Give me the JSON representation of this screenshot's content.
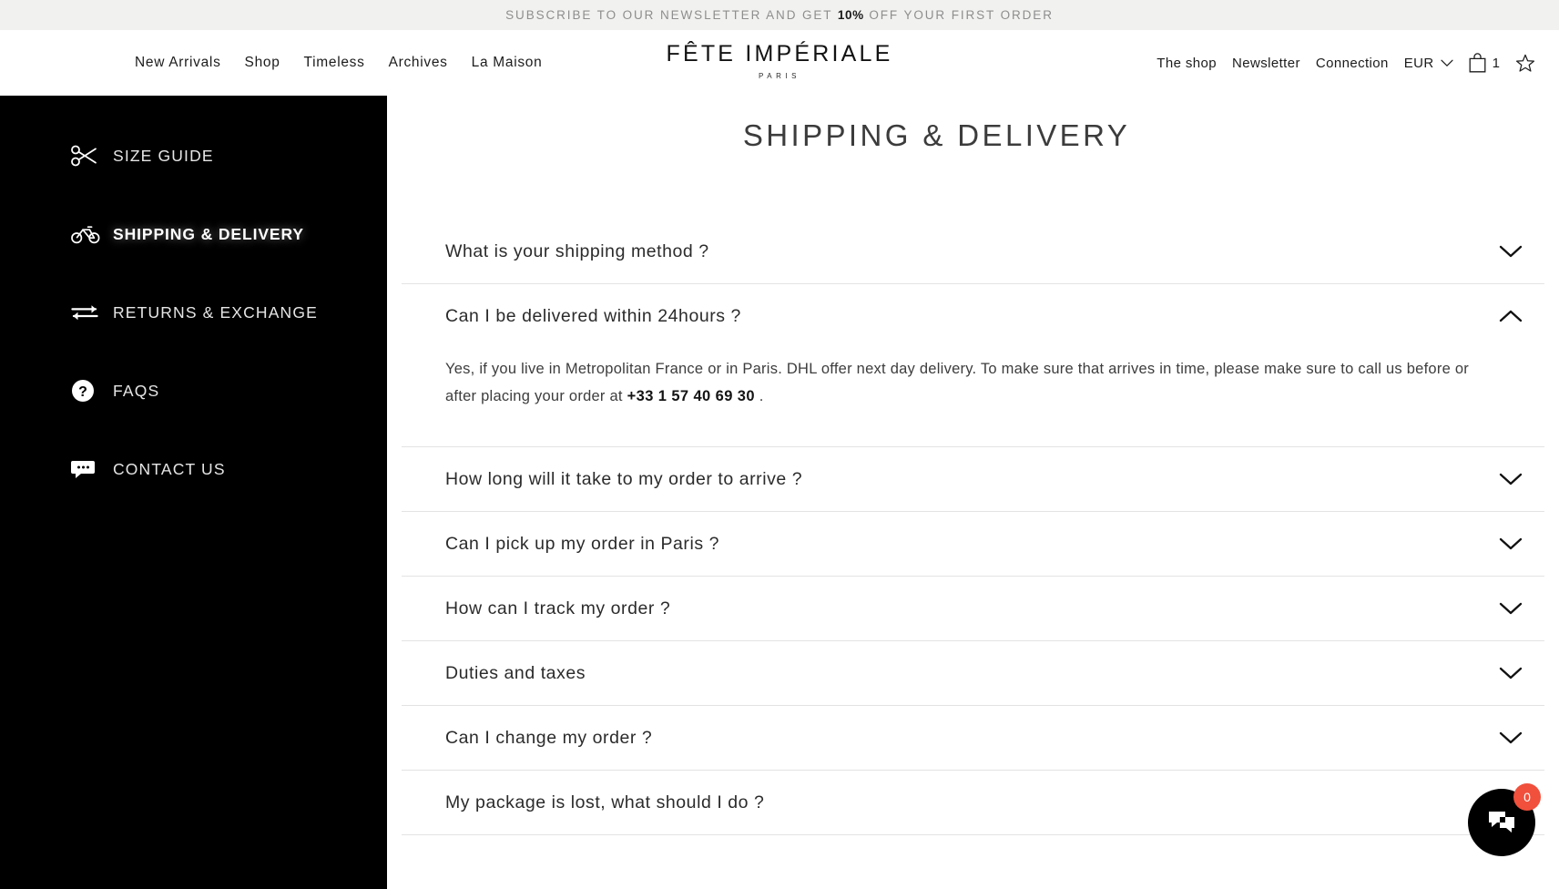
{
  "announcement": {
    "prefix": "SUBSCRIBE TO OUR NEWSLETTER AND GET ",
    "highlight": "10%",
    "suffix": " OFF YOUR FIRST ORDER"
  },
  "header": {
    "primary_nav": [
      {
        "label": "New Arrivals"
      },
      {
        "label": "Shop"
      },
      {
        "label": "Timeless"
      },
      {
        "label": "Archives"
      },
      {
        "label": "La Maison"
      }
    ],
    "brand": {
      "name": "FÊTE IMPÉRIALE",
      "tagline": "PARIS"
    },
    "utility_nav": [
      {
        "label": "The shop"
      },
      {
        "label": "Newsletter"
      },
      {
        "label": "Connection"
      }
    ],
    "currency": {
      "value": "EUR",
      "icon": "chevron-down-icon"
    },
    "cart": {
      "icon": "shopping-bag-icon",
      "count": "1"
    },
    "wishlist": {
      "icon": "star-icon"
    }
  },
  "sidebar": {
    "items": [
      {
        "label": "SIZE GUIDE",
        "icon": "scissors-icon",
        "active": false
      },
      {
        "label": "SHIPPING & DELIVERY",
        "icon": "bicycle-icon",
        "active": true
      },
      {
        "label": "RETURNS & EXCHANGE",
        "icon": "exchange-arrows-icon",
        "active": false
      },
      {
        "label": "FAQS",
        "icon": "question-circle-icon",
        "active": false
      },
      {
        "label": "CONTACT US",
        "icon": "chat-bubble-icon",
        "active": false
      }
    ]
  },
  "main": {
    "title": "SHIPPING & DELIVERY",
    "faqs": [
      {
        "question": "What is your shipping method ?",
        "expanded": false,
        "chevron": "chevron-down-icon"
      },
      {
        "question": "Can I be delivered within 24hours ?",
        "expanded": true,
        "chevron": "chevron-up-icon",
        "answer_before": "Yes, if you live in Metropolitan France or in Paris. DHL offer next day delivery. To make sure that arrives in time, please make sure to call us before or after placing your order at ",
        "answer_phone": "+33 1 57 40 69 30",
        "answer_after": " ."
      },
      {
        "question": "How long will it take to my order to arrive ?",
        "expanded": false,
        "chevron": "chevron-down-icon"
      },
      {
        "question": "Can I pick up my order in Paris ?",
        "expanded": false,
        "chevron": "chevron-down-icon"
      },
      {
        "question": "How can I track my order ?",
        "expanded": false,
        "chevron": "chevron-down-icon"
      },
      {
        "question": "Duties and taxes",
        "expanded": false,
        "chevron": "chevron-down-icon"
      },
      {
        "question": "Can I change my order ?",
        "expanded": false,
        "chevron": "chevron-down-icon"
      },
      {
        "question": "My package is lost, what should I do ?",
        "expanded": false,
        "chevron": "chevron-down-icon"
      }
    ]
  },
  "chat_widget": {
    "icon": "chat-bubble-icon",
    "badge_count": "0",
    "badge_color": "#f0503c",
    "button_color": "#000000"
  },
  "colors": {
    "announcement_bg": "#f1f1ef",
    "sidebar_bg": "#000000",
    "text_primary": "#1c1c1c",
    "divider": "#e3e3e3"
  }
}
